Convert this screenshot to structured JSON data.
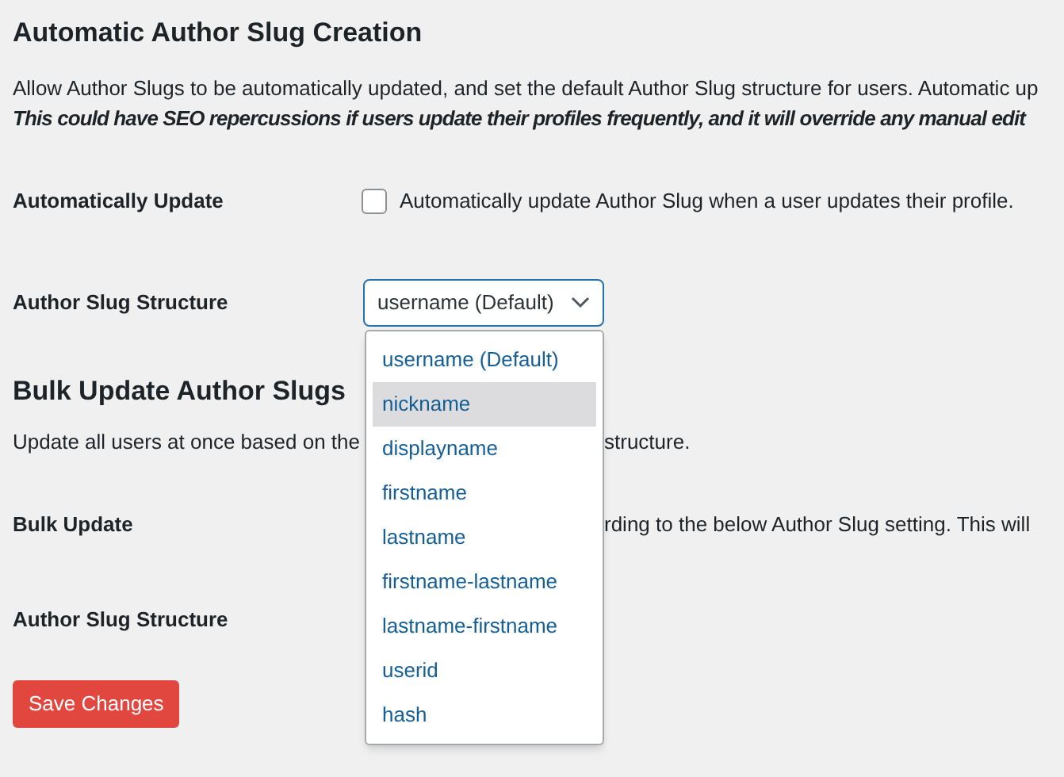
{
  "section_1": {
    "title": "Automatic Author Slug Creation",
    "description": [
      {
        "text": "Allow Author Slugs to be automatically updated, and set the default Author Slug structure for users. Automatic up",
        "italic": false
      },
      {
        "text": "This could have SEO repercussions if users update their profiles frequently, and it will override any manual edit",
        "italic": true
      }
    ],
    "auto_update": {
      "label": "Automatically Update",
      "checked": false,
      "text": "Automatically update Author Slug when a user updates their profile."
    },
    "structure": {
      "label": "Author Slug Structure",
      "value": "username (Default)",
      "expanded": true,
      "options": [
        {
          "label": "username (Default)",
          "highlighted": false
        },
        {
          "label": "nickname",
          "highlighted": true
        },
        {
          "label": "displayname",
          "highlighted": false
        },
        {
          "label": "firstname",
          "highlighted": false
        },
        {
          "label": "lastname",
          "highlighted": false
        },
        {
          "label": "firstname-lastname",
          "highlighted": false
        },
        {
          "label": "lastname-firstname",
          "highlighted": false
        },
        {
          "label": "userid",
          "highlighted": false
        },
        {
          "label": "hash",
          "highlighted": false
        }
      ]
    }
  },
  "section_2": {
    "title": "Bulk Update Author Slugs",
    "description": {
      "text_before": "Update all users at once based on the",
      "text_after": "structure."
    },
    "bulk_update": {
      "label": "Bulk Update",
      "text": "rding to the below Author Slug setting. This will"
    },
    "structure": {
      "label": "Author Slug Structure"
    }
  },
  "save_button": "Save Changes"
}
